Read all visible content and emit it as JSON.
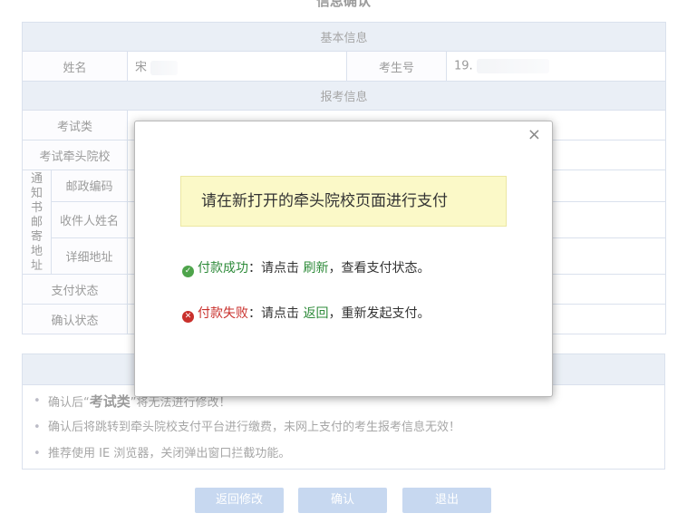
{
  "page": {
    "title": "信息确认"
  },
  "basic": {
    "section_title": "基本信息",
    "name_label": "姓名",
    "name_value": "宋",
    "exam_no_label": "考生号",
    "exam_no_value": "19."
  },
  "apply": {
    "section_title": "报考信息",
    "exam_type_label": "考试类",
    "lead_school_label": "考试牵头院校",
    "notice_label_chars": [
      "通",
      "知",
      "书",
      "邮",
      "寄",
      "地",
      "址"
    ],
    "postal_code_label": "邮政编码",
    "recipient_label": "收件人姓名",
    "address_label": "详细地址",
    "pay_status_label": "支付状态",
    "confirm_status_label": "确认状态"
  },
  "notes": {
    "items": [
      {
        "prefix": "确认后“",
        "bold": "考试类",
        "suffix": "”将无法进行修改！"
      },
      {
        "prefix": "确认后将跳转到牵头院校支付平台进行缴费，未网上支付的考生报考信息无效！",
        "bold": "",
        "suffix": ""
      },
      {
        "prefix": "推荐使用 IE 浏览器，关闭弹出窗口拦截功能。",
        "bold": "",
        "suffix": ""
      }
    ]
  },
  "buttons": {
    "back": "返回修改",
    "confirm": "确认",
    "exit": "退出"
  },
  "modal": {
    "close_glyph": "×",
    "banner": "请在新打开的牵头院校页面进行支付",
    "success": {
      "status": "付款成功",
      "text1": "：请点击 ",
      "link": "刷新",
      "text2": "，查看支付状态。"
    },
    "failure": {
      "status": "付款失败",
      "text1": "：请点击 ",
      "link": "返回",
      "text2": "，重新发起支付。"
    },
    "icons": {
      "success": "check-circle-icon",
      "failure": "x-circle-icon"
    }
  },
  "colors": {
    "section_bg": "#dfe6f1",
    "button_bg": "#a9c4e8",
    "banner_bg": "#fbf9c8",
    "success": "#2e8b3a",
    "failure": "#c9302c"
  }
}
